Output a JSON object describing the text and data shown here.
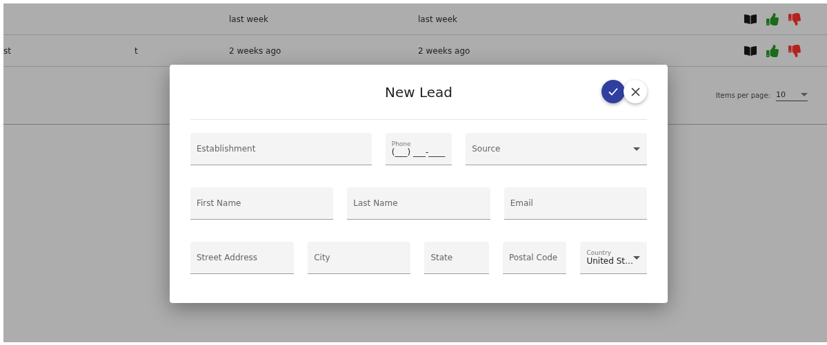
{
  "table": {
    "rows": [
      {
        "cells": [
          "",
          "",
          "last week",
          "last week"
        ]
      },
      {
        "cells": [
          "st",
          "t",
          "2 weeks ago",
          "2 weeks ago"
        ]
      }
    ]
  },
  "pagination": {
    "label": "Items per page:",
    "value": "10"
  },
  "dialog": {
    "title": "New Lead",
    "field_rows": [
      [
        {
          "kind": "text",
          "label": "Establishment"
        },
        {
          "kind": "text",
          "label": "Phone",
          "value": "(___) ___-____"
        },
        {
          "kind": "select",
          "label": "Source"
        }
      ],
      [
        {
          "kind": "text",
          "label": "First Name"
        },
        {
          "kind": "text",
          "label": "Last Name"
        },
        {
          "kind": "text",
          "label": "Email"
        }
      ],
      [
        {
          "kind": "text",
          "label": "Street Address"
        },
        {
          "kind": "text",
          "label": "City"
        },
        {
          "kind": "text",
          "label": "State"
        },
        {
          "kind": "text",
          "label": "Postal Code"
        },
        {
          "kind": "select",
          "label": "Country",
          "value": "United St…"
        }
      ]
    ]
  }
}
